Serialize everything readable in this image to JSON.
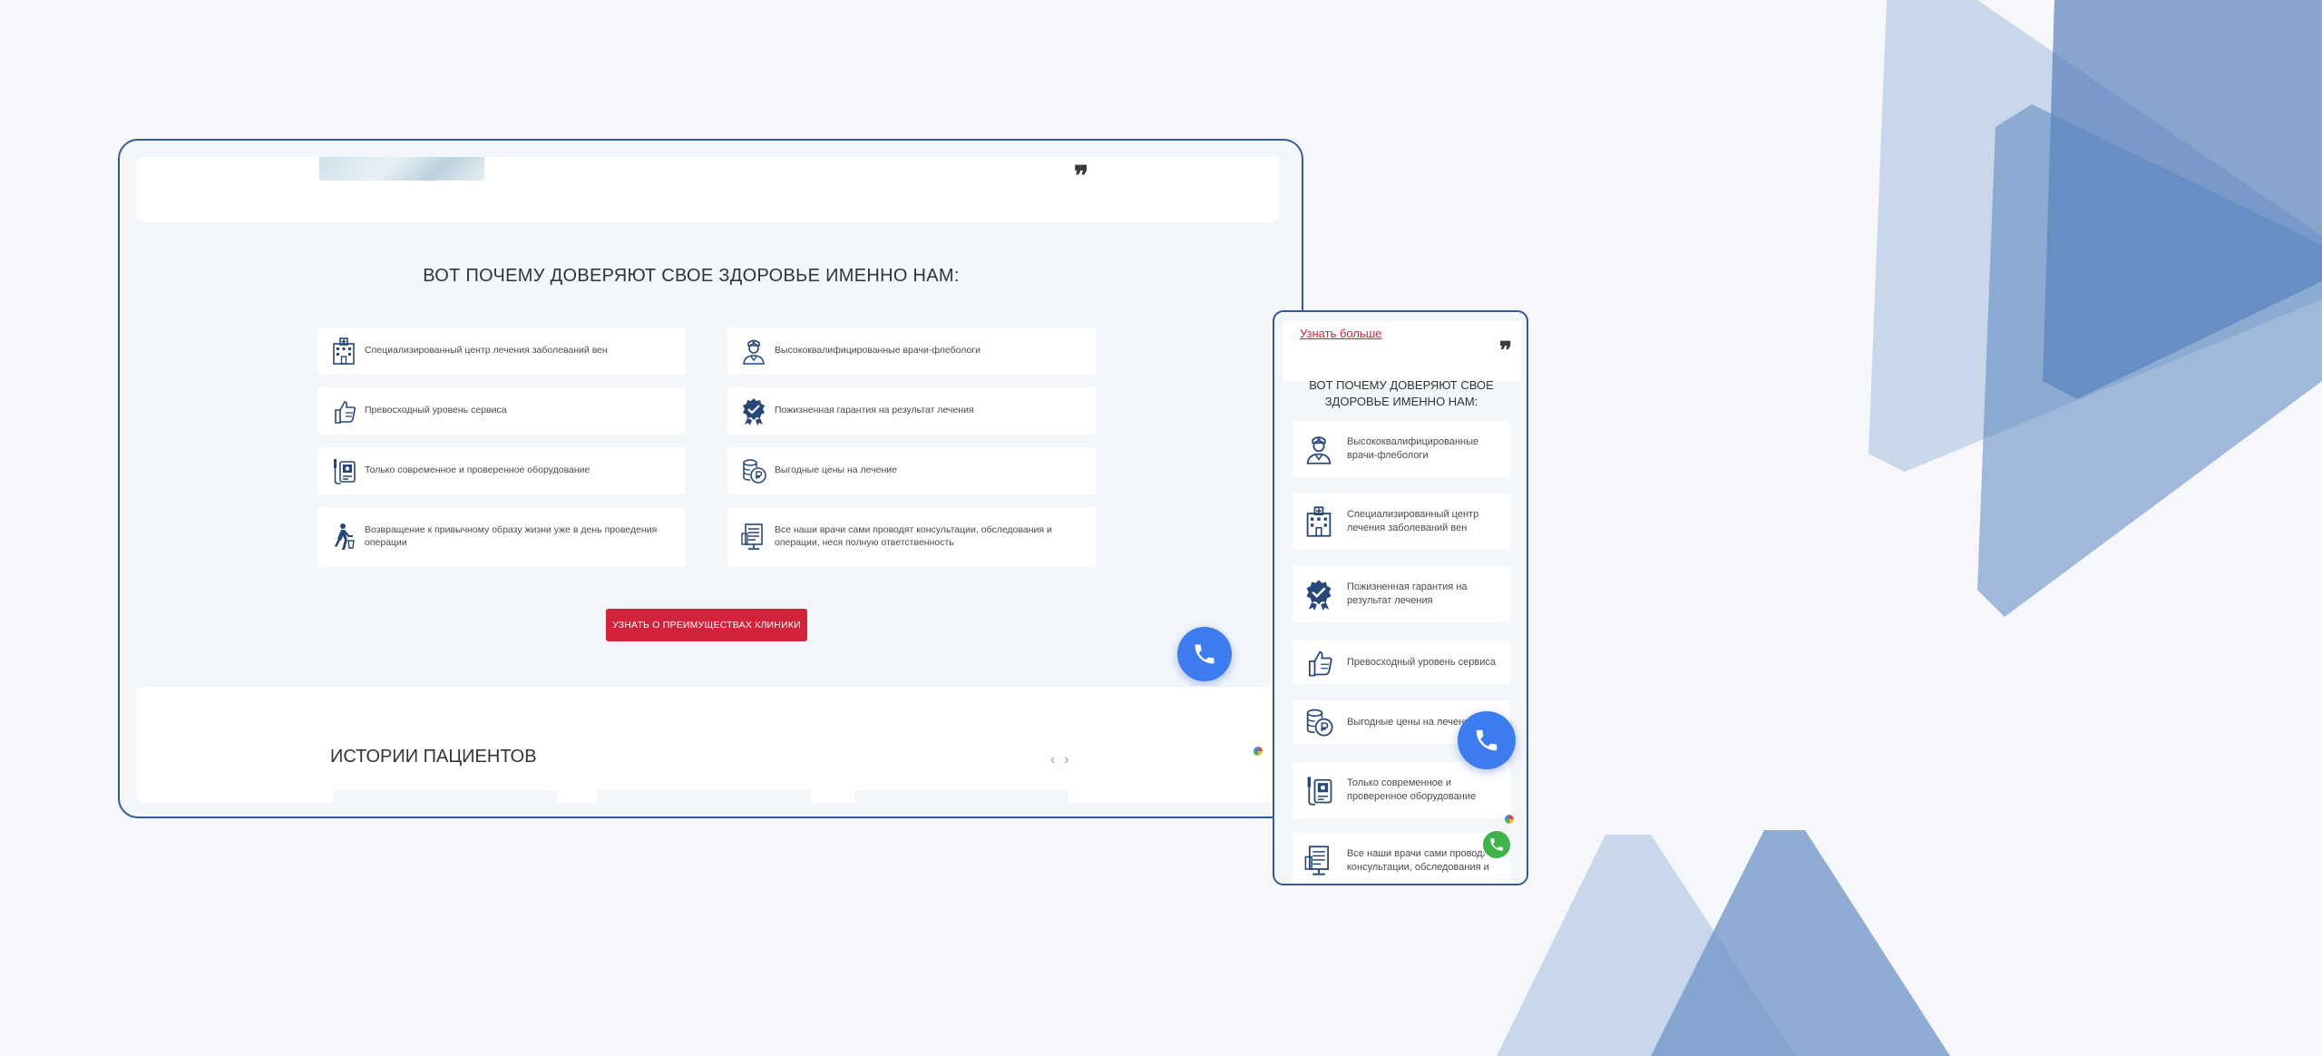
{
  "colors": {
    "accent_red": "#d3233b",
    "frame_blue": "#2f5d9b",
    "call_blue": "#3d7cf0",
    "icon_navy": "#27477a"
  },
  "desktop": {
    "title": "ВОТ ПОЧЕМУ ДОВЕРЯЮТ СВОЕ ЗДОРОВЬЕ ИМЕННО НАМ:",
    "features": [
      {
        "icon": "clinic-building-icon",
        "text": "Специализированный центр лечения заболеваний вен"
      },
      {
        "icon": "doctor-icon",
        "text": "Высококвалифицированные врачи-флебологи"
      },
      {
        "icon": "thumbs-up-icon",
        "text": "Превосходный уровень сервиса"
      },
      {
        "icon": "guarantee-badge-icon",
        "text": "Пожизненная гарантия на результат лечения"
      },
      {
        "icon": "medical-equipment-icon",
        "text": "Только современное и проверенное оборудование"
      },
      {
        "icon": "coins-icon",
        "text": "Выгодные цены на лечение"
      },
      {
        "icon": "walking-person-icon",
        "text": "Возвращение к привычному образу жизни уже в день проведения операции"
      },
      {
        "icon": "document-monitor-icon",
        "text": "Все наши врачи сами проводят консультации, обследования и операции, неся полную ответственность"
      }
    ],
    "cta_label": "УЗНАТЬ О ПРЕИМУЩЕСТВАХ КЛИНИКИ",
    "stories_title": "ИСТОРИИ ПАЦИЕНТОВ",
    "quote_mark": "❞",
    "prev_arrow": "‹",
    "next_arrow": "›"
  },
  "mobile": {
    "more_link": "Узнать больше",
    "quote_mark": "❞",
    "title": "ВОТ ПОЧЕМУ ДОВЕРЯЮТ СВОЕ ЗДОРОВЬЕ ИМЕННО НАМ:",
    "features": [
      {
        "icon": "doctor-icon",
        "text": "Высококвалифицированные врачи-флебологи"
      },
      {
        "icon": "clinic-building-icon",
        "text": "Специализированный центр лечения заболеваний вен"
      },
      {
        "icon": "guarantee-badge-icon",
        "text": "Пожизненная гарантия на результат лечения"
      },
      {
        "icon": "thumbs-up-icon",
        "text": "Превосходный уровень сервиса"
      },
      {
        "icon": "coins-icon",
        "text": "Выгодные цены на лечение"
      },
      {
        "icon": "medical-equipment-icon",
        "text": "Только современное и проверенное оборудование"
      },
      {
        "icon": "document-monitor-icon",
        "text": "Все наши врачи сами проводят консультации, обследования и"
      }
    ]
  }
}
